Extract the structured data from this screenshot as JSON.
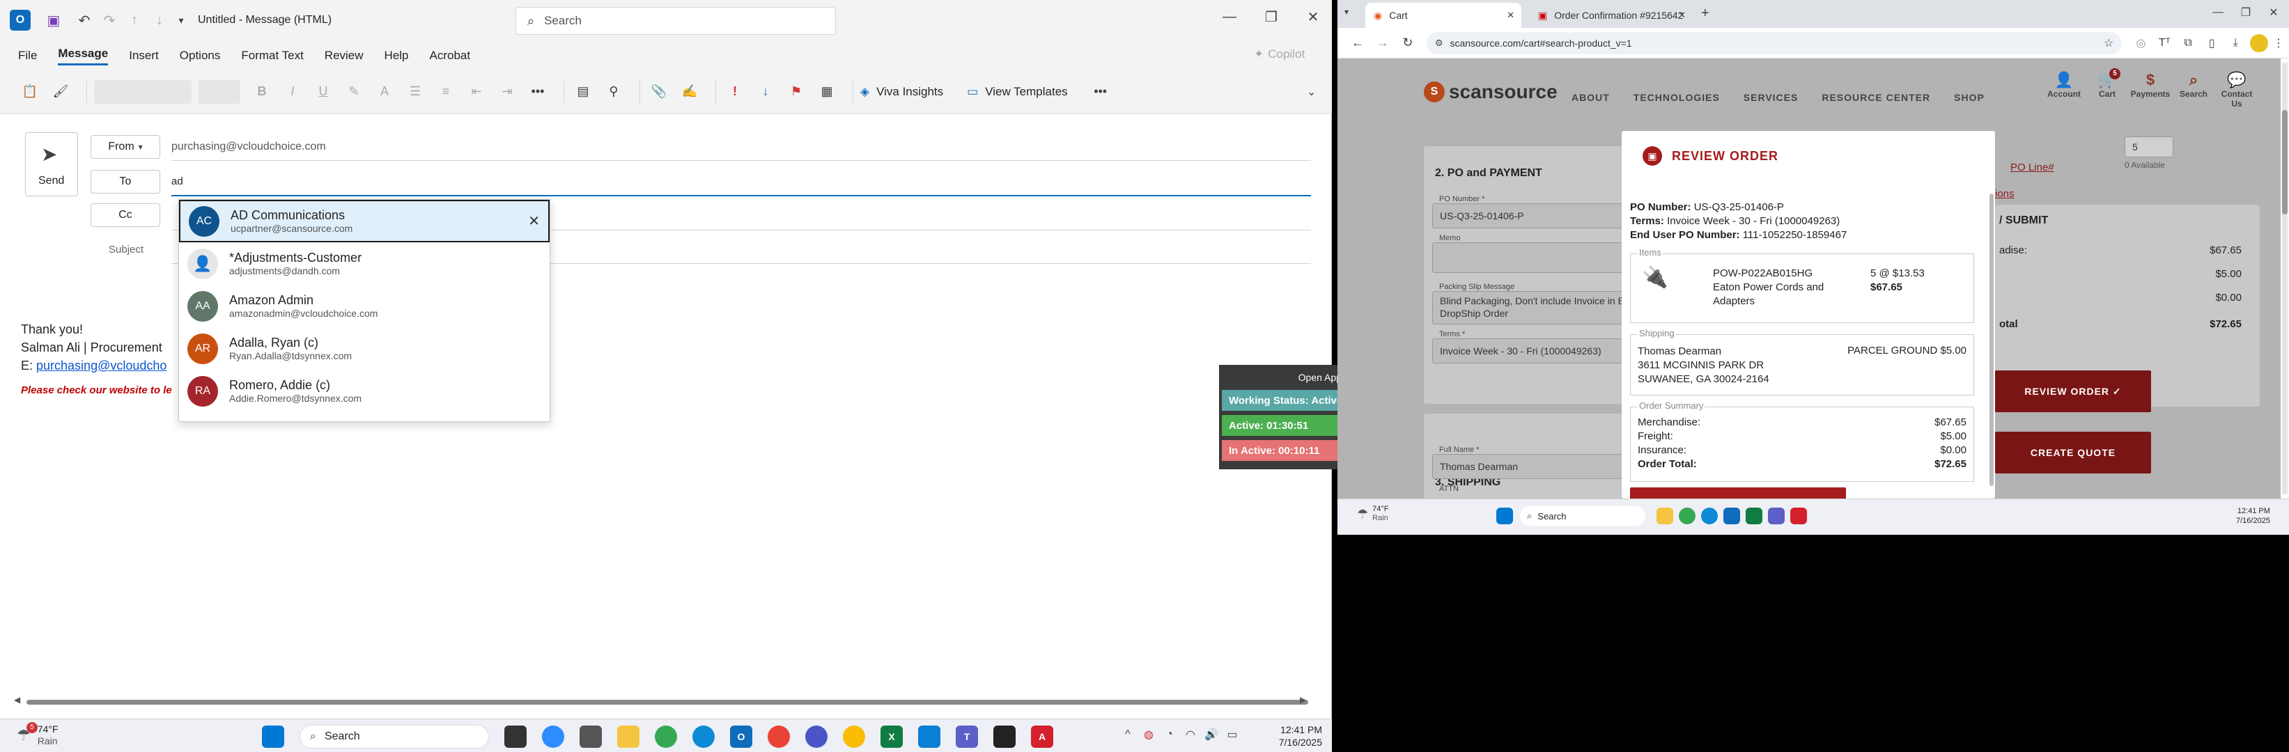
{
  "outlook": {
    "title": "Untitled - Message (HTML)",
    "search_placeholder": "Search",
    "tabs": [
      "File",
      "Message",
      "Insert",
      "Options",
      "Format Text",
      "Review",
      "Help",
      "Acrobat"
    ],
    "copilot_label": "Copilot",
    "viva_label": "Viva Insights",
    "templates_label": "View Templates",
    "send_label": "Send",
    "from_label": "From",
    "from_value": "purchasing@vcloudchoice.com",
    "to_label": "To",
    "to_value": "ad",
    "cc_label": "Cc",
    "subject_label": "Subject",
    "body_line1": "Thank you!",
    "body_line2": "Salman Ali  | Procurement",
    "body_line3_prefix": "E: ",
    "body_line3_link": "purchasing@vcloudcho",
    "body_line4": "Please check our website to le",
    "suggestions": [
      {
        "initials": "AC",
        "name": "AD Communications",
        "email": "ucpartner@scansource.com",
        "color": "#0f548c"
      },
      {
        "initials": "",
        "name": "*Adjustments-Customer",
        "email": "adjustments@dandh.com",
        "color": "#e6e6e6"
      },
      {
        "initials": "AA",
        "name": "Amazon Admin",
        "email": "amazonadmin@vcloudchoice.com",
        "color": "#607769"
      },
      {
        "initials": "AR",
        "name": "Adalla, Ryan (c)",
        "email": "Ryan.Adalla@tdsynnex.com",
        "color": "#ca5010"
      },
      {
        "initials": "RA",
        "name": "Romero, Addie (c)",
        "email": "Addie.Romero@tdsynnex.com",
        "color": "#a4262c"
      }
    ]
  },
  "timer": {
    "open_app": "Open App",
    "status": "Working Status: Active",
    "active": "Active: 01:30:51",
    "inactive": "In Active: 00:10:11"
  },
  "chrome": {
    "tab1": "Cart",
    "tab2": "Order Confirmation #9215642",
    "url": "scansource.com/cart#search-product_v=1",
    "site": {
      "logo": "scansource",
      "nav": [
        "ABOUT",
        "TECHNOLOGIES",
        "SERVICES",
        "RESOURCE CENTER",
        "SHOP"
      ],
      "nav_icons": [
        "Account",
        "Cart",
        "Payments",
        "Search",
        "Contact Us"
      ],
      "cart_count": "5",
      "po_heading": "2. PO and PAYMENT",
      "po_label": "PO Number *",
      "po_value": "US-Q3-25-01406-P",
      "memo_label": "Memo",
      "packing_label": "Packing Slip Message",
      "packing_value": "Blind Packaging, Don't include Invoice in Box, DropShip Order",
      "terms_label": "Terms *",
      "terms_value": "Invoice Week - 30 - Fri (1000049263)",
      "shipping_heading": "3. SHIPPING",
      "fullname_label": "Full Name *",
      "fullname_value": "Thomas Dearman",
      "attn_label": "ATTN",
      "qty": "5",
      "available": "0 Available",
      "poline": "PO Line#",
      "ions": "ions",
      "submit": "/ SUBMIT",
      "side_rows": [
        [
          "adise:",
          "$67.65"
        ],
        [
          "",
          "$5.00"
        ],
        [
          "",
          "$0.00"
        ],
        [
          "otal",
          "$72.65"
        ]
      ],
      "review_btn": "REVIEW ORDER ✓",
      "quote_btn": "CREATE QUOTE"
    },
    "modal": {
      "title": "REVIEW ORDER",
      "po_k": "PO Number:",
      "po_v": "US-Q3-25-01406-P",
      "terms_k": "Terms:",
      "terms_v": "Invoice Week - 30 - Fri (1000049263)",
      "enduser_k": "End User PO Number:",
      "enduser_v": "111-1052250-1859467",
      "items_label": "Items",
      "item_sku": "POW-P022AB015HG",
      "item_desc": "Eaton Power Cords and Adapters",
      "item_qty": "5 @ $13.53",
      "item_total": "$67.65",
      "shipping_label": "Shipping",
      "ship_name": "Thomas Dearman",
      "ship_method": "PARCEL GROUND $5.00",
      "ship_addr1": "3611 MCGINNIS PARK DR",
      "ship_addr2": "SUWANEE, GA 30024-2164",
      "summary_label": "Order Summary",
      "summary": [
        [
          "Merchandise:",
          "$67.65"
        ],
        [
          "Freight:",
          "$5.00"
        ],
        [
          "Insurance:",
          "$0.00"
        ],
        [
          "Order Total:",
          "$72.65"
        ]
      ]
    }
  },
  "taskbar": {
    "weather_temp": "74°F",
    "weather_desc": "Rain",
    "weather_badge": "5",
    "search": "Search",
    "time": "12:41 PM",
    "date": "7/16/2025"
  },
  "taskbar2": {
    "weather_temp": "74°F",
    "weather_desc": "Rain",
    "search": "Search",
    "time": "12:41 PM",
    "date": "7/16/2025"
  }
}
